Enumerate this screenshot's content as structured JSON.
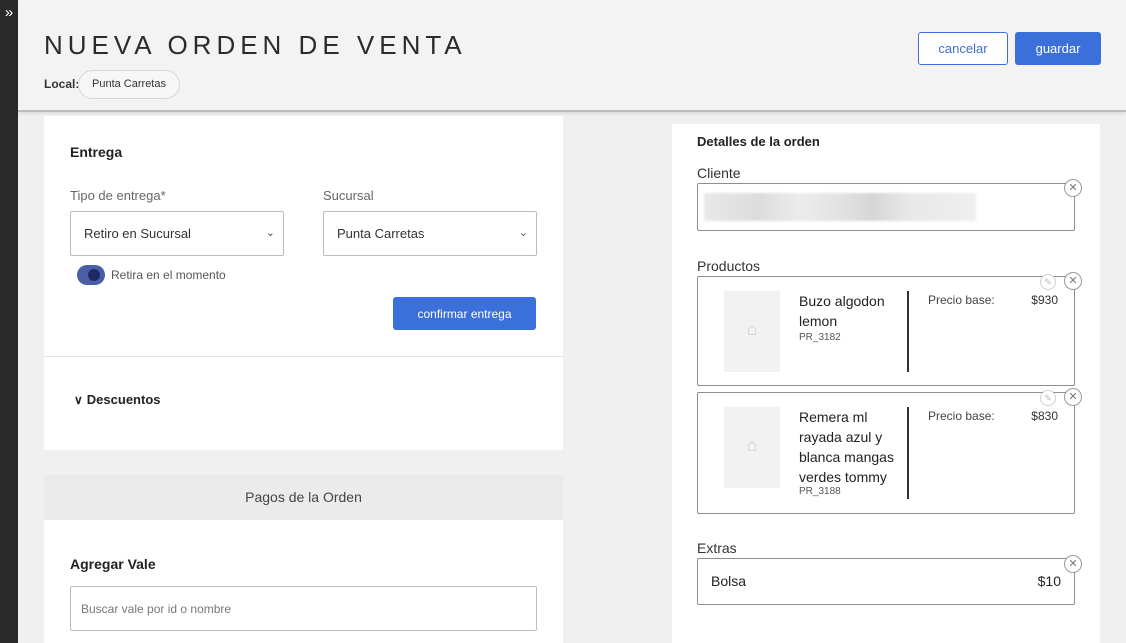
{
  "header": {
    "title": "NUEVA ORDEN DE VENTA",
    "local_label": "Local:",
    "local_value": "Punta Carretas",
    "cancel_label": "cancelar",
    "save_label": "guardar"
  },
  "entrega": {
    "title": "Entrega",
    "tipo_label": "Tipo de entrega*",
    "tipo_value": "Retiro en Sucursal",
    "sucursal_label": "Sucursal",
    "sucursal_value": "Punta Carretas",
    "toggle_label": "Retira en el momento",
    "toggle_on": true,
    "confirm_label": "confirmar entrega"
  },
  "descuentos": {
    "label": "Descuentos"
  },
  "pagos": {
    "header": "Pagos de la Orden",
    "vale_title": "Agregar Vale",
    "vale_placeholder": "Buscar vale por id o nombre"
  },
  "detalles": {
    "title": "Detalles de la orden",
    "cliente_label": "Cliente",
    "productos_label": "Productos",
    "productos": [
      {
        "name": "Buzo algodon lemon",
        "code": "PR_3182",
        "price_label": "Precio base:",
        "price": "$930"
      },
      {
        "name": "Remera ml rayada azul y blanca mangas verdes tommy",
        "code": "PR_3188",
        "price_label": "Precio base:",
        "price": "$830"
      }
    ],
    "extras_label": "Extras",
    "extras": [
      {
        "name": "Bolsa",
        "price": "$10"
      }
    ]
  },
  "icons": {
    "expand": "double-chevron-right-icon",
    "close": "close-circle-icon",
    "edit": "pencil-icon",
    "chevron": "chevron-down-icon",
    "image_placeholder": "hanger-icon"
  },
  "colors": {
    "primary": "#3b70db",
    "toggle": "#4a5ea8",
    "rail": "#2a2a2a"
  }
}
